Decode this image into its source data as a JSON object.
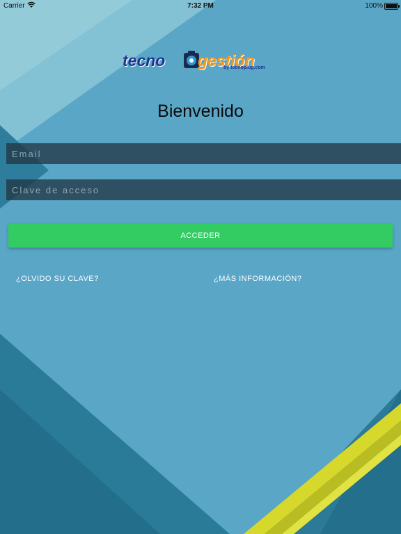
{
  "status_bar": {
    "carrier": "Carrier",
    "time": "7:32 PM",
    "battery": "100%"
  },
  "logo": {
    "word_a": "tecno",
    "word_b": "gestión",
    "tagline": "by tecnoplug.com"
  },
  "welcome": "Bienvenido",
  "form": {
    "email_placeholder": "Email",
    "email_value": "",
    "password_placeholder": "Clave de acceso",
    "password_value": "",
    "submit_label": "ACCEDER"
  },
  "links": {
    "forgot": "¿OLVIDO SU CLAVE?",
    "info": "¿MÁS INFORMACIÓN?"
  },
  "colors": {
    "background": "#5fa9c9",
    "button": "#33cc63",
    "logo_blue": "#1b3690",
    "logo_orange": "#f39a1e",
    "accent_stripe": "#c8cc2a"
  },
  "icons": [
    "wifi-icon",
    "battery-icon",
    "logo-icon"
  ]
}
